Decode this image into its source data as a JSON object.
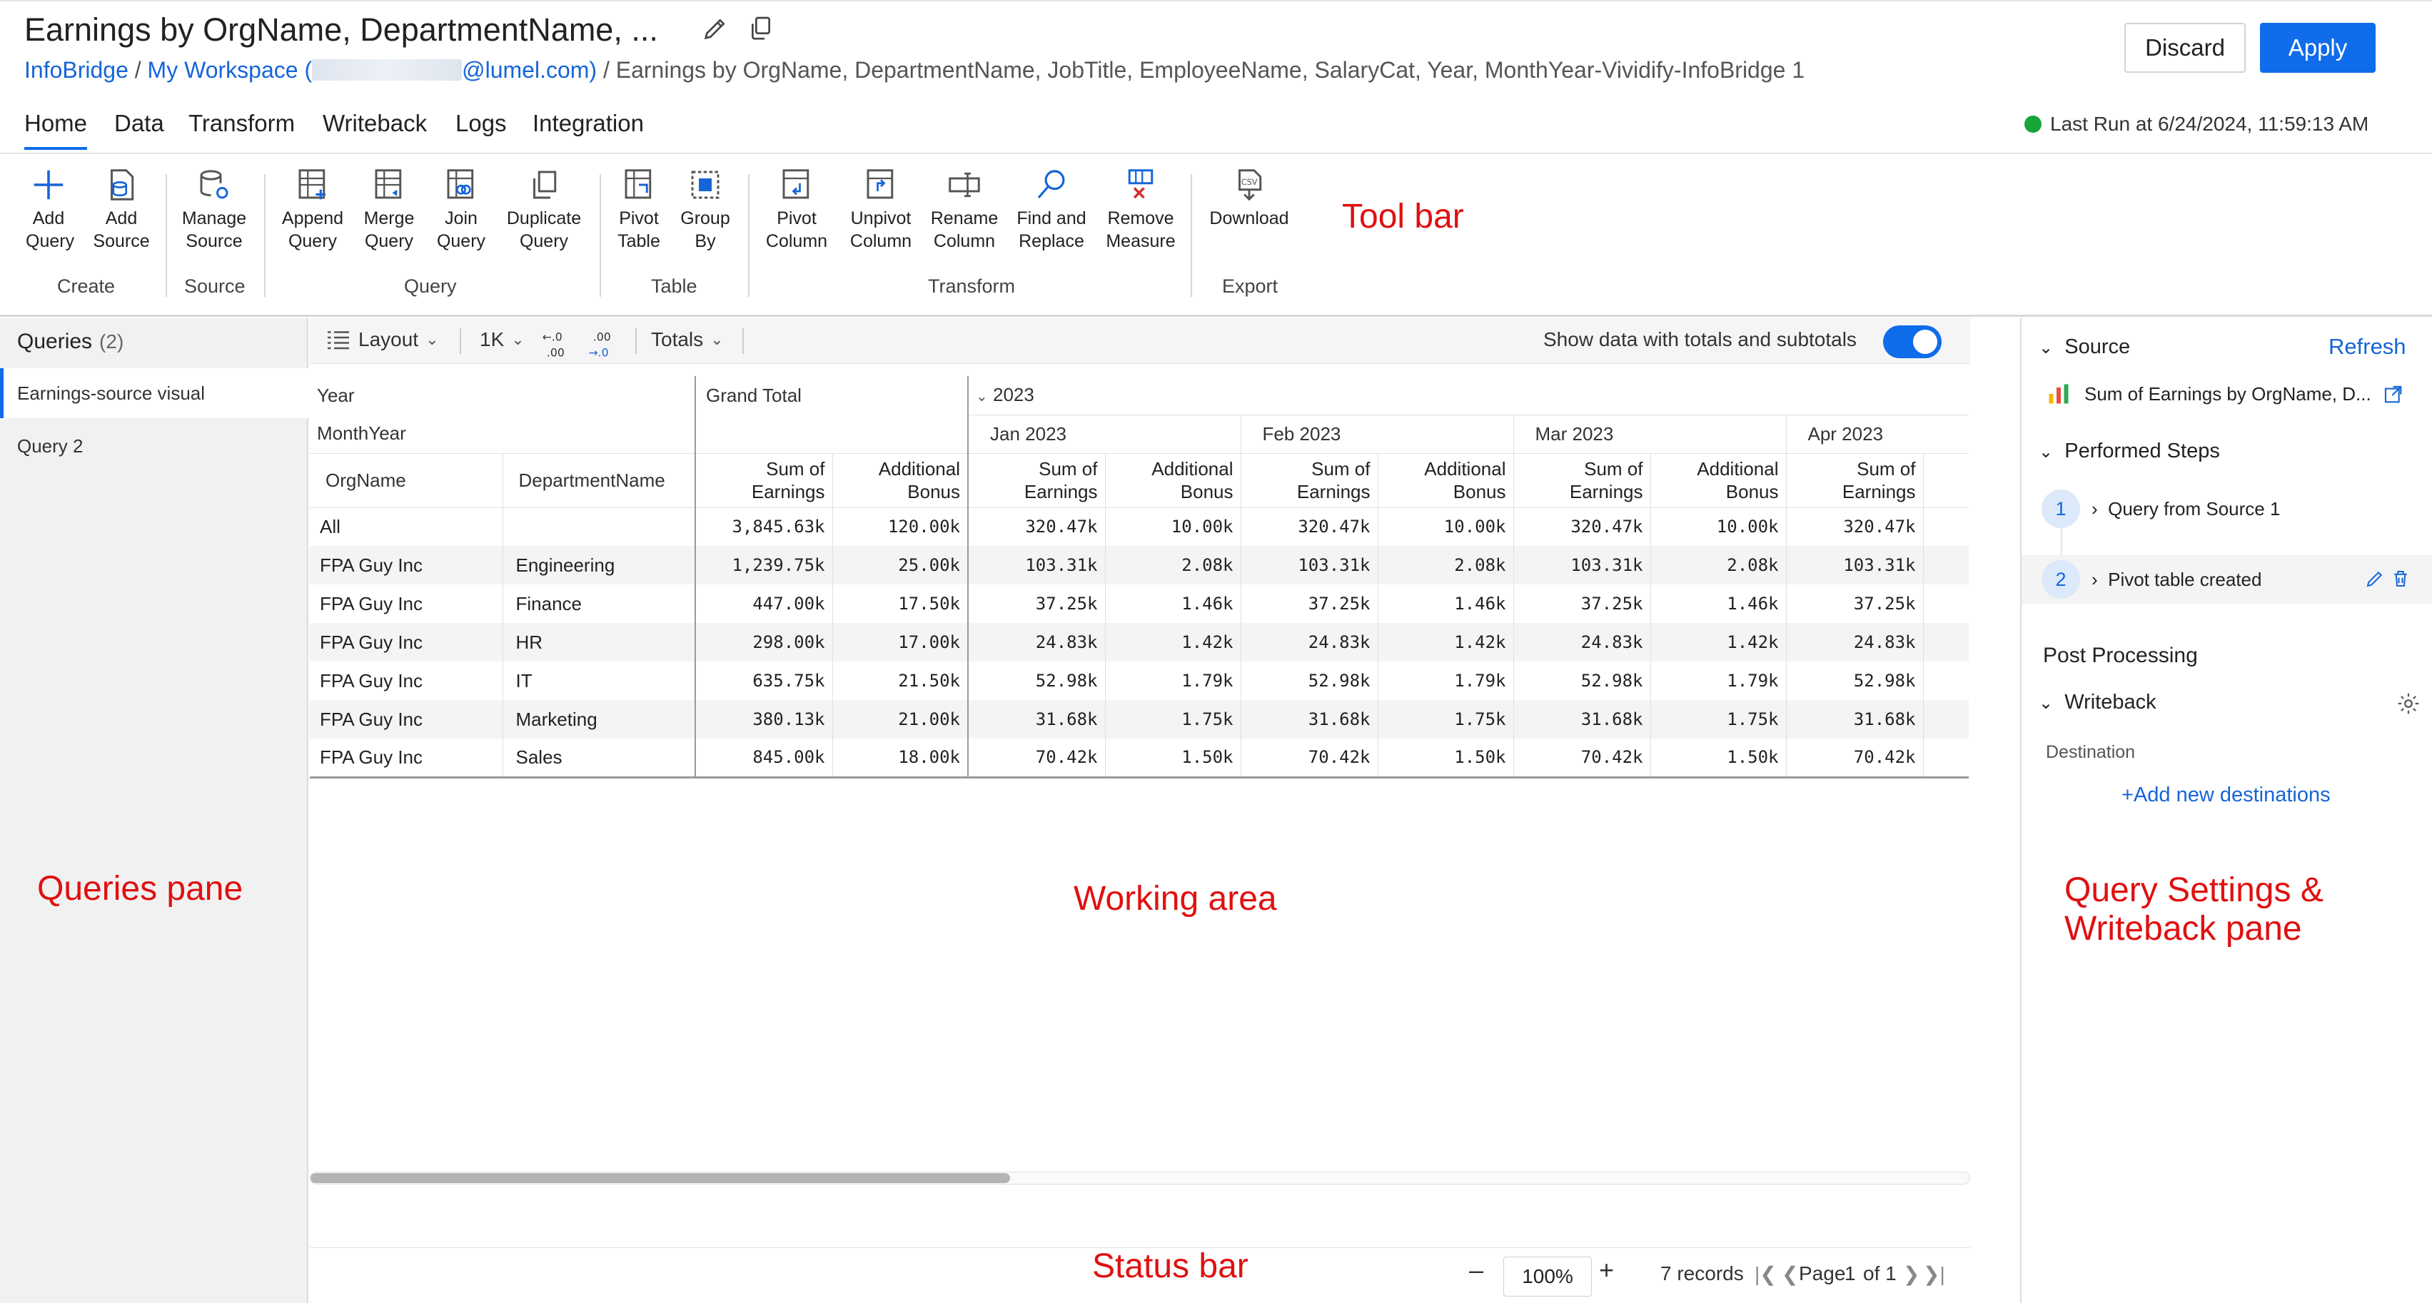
{
  "header": {
    "title": "Earnings by OrgName, DepartmentName, ...",
    "breadcrumb": {
      "part1": "InfoBridge",
      "sep1": " / ",
      "part2_prefix": "My Workspace (",
      "part2_suffix": "@lumel.com)",
      "rest": " / Earnings by OrgName, DepartmentName, JobTitle, EmployeeName, SalaryCat, Year, MonthYear-Vividify-InfoBridge 1"
    },
    "discard_label": "Discard",
    "apply_label": "Apply",
    "icons": [
      "pencil-icon",
      "copy-icon"
    ]
  },
  "menu": {
    "tabs": [
      "Home",
      "Data",
      "Transform",
      "Writeback",
      "Logs",
      "Integration"
    ],
    "active": "Home",
    "last_run": "Last Run at 6/24/2024, 11:59:13 AM",
    "status_color": "#17a53a"
  },
  "toolbar": {
    "items": {
      "add_query": [
        "Add",
        "Query"
      ],
      "add_source": [
        "Add",
        "Source"
      ],
      "manage_source": [
        "Manage",
        "Source"
      ],
      "append_query": [
        "Append",
        "Query"
      ],
      "merge_query": [
        "Merge",
        "Query"
      ],
      "join_query": [
        "Join",
        "Query"
      ],
      "duplicate_query": [
        "Duplicate",
        "Query"
      ],
      "pivot_table": [
        "Pivot",
        "Table"
      ],
      "group_by": [
        "Group",
        "By"
      ],
      "pivot_column": [
        "Pivot",
        "Column"
      ],
      "unpivot_column": [
        "Unpivot",
        "Column"
      ],
      "rename_column": [
        "Rename",
        "Column"
      ],
      "find_replace": [
        "Find and",
        "Replace"
      ],
      "remove_measure": [
        "Remove",
        "Measure"
      ],
      "download": [
        "Download",
        ""
      ]
    },
    "groups": {
      "create": "Create",
      "source": "Source",
      "query": "Query",
      "table": "Table",
      "transform": "Transform",
      "export": "Export"
    }
  },
  "annotations": {
    "toolbar": "Tool bar",
    "queries": "Queries pane",
    "working": "Working area",
    "settings_line1": "Query Settings &",
    "settings_line2": "Writeback pane",
    "status": "Status bar"
  },
  "queries_pane": {
    "title": "Queries",
    "count": "(2)",
    "items": [
      "Earnings-source visual",
      "Query 2"
    ]
  },
  "workbar": {
    "layout": "Layout",
    "rows": "1K",
    "totals": "Totals",
    "show_totals_label": "Show data with totals and subtotals",
    "show_totals_on": true,
    "decimal_icons": [
      "decrease-decimal-icon",
      "increase-decimal-icon"
    ]
  },
  "grid": {
    "year_label": "Year",
    "monthyear_label": "MonthYear",
    "grand_total": "Grand Total",
    "year_value": "2023",
    "months": [
      "Jan 2023",
      "Feb 2023",
      "Mar 2023",
      "Apr 2023"
    ],
    "col_org": "OrgName",
    "col_dept": "DepartmentName",
    "measures": {
      "sum_line1": "Sum of",
      "sum_line2": "Earnings",
      "bonus_line1": "Additional",
      "bonus_line2": "Bonus"
    },
    "rows": [
      {
        "org": "All",
        "dept": "",
        "gt_sum": "3,845.63k",
        "gt_bonus": "120.00k",
        "m_sum": "320.47k",
        "m_bonus": "10.00k"
      },
      {
        "org": "FPA Guy Inc",
        "dept": "Engineering",
        "gt_sum": "1,239.75k",
        "gt_bonus": "25.00k",
        "m_sum": "103.31k",
        "m_bonus": "2.08k"
      },
      {
        "org": "FPA Guy Inc",
        "dept": "Finance",
        "gt_sum": "447.00k",
        "gt_bonus": "17.50k",
        "m_sum": "37.25k",
        "m_bonus": "1.46k"
      },
      {
        "org": "FPA Guy Inc",
        "dept": "HR",
        "gt_sum": "298.00k",
        "gt_bonus": "17.00k",
        "m_sum": "24.83k",
        "m_bonus": "1.42k"
      },
      {
        "org": "FPA Guy Inc",
        "dept": "IT",
        "gt_sum": "635.75k",
        "gt_bonus": "21.50k",
        "m_sum": "52.98k",
        "m_bonus": "1.79k"
      },
      {
        "org": "FPA Guy Inc",
        "dept": "Marketing",
        "gt_sum": "380.13k",
        "gt_bonus": "21.00k",
        "m_sum": "31.68k",
        "m_bonus": "1.75k"
      },
      {
        "org": "FPA Guy Inc",
        "dept": "Sales",
        "gt_sum": "845.00k",
        "gt_bonus": "18.00k",
        "m_sum": "70.42k",
        "m_bonus": "1.50k"
      }
    ]
  },
  "statusbar": {
    "zoom": "100%",
    "records": "7 records",
    "page": "Page",
    "page_num": "1",
    "of": "of 1"
  },
  "settings_pane": {
    "source_title": "Source",
    "refresh": "Refresh",
    "source_name": "Sum of Earnings by OrgName, D...",
    "performed_steps": "Performed Steps",
    "steps": [
      {
        "num": "1",
        "label": "Query from Source 1"
      },
      {
        "num": "2",
        "label": "Pivot table created"
      }
    ],
    "post_processing": "Post Processing",
    "writeback": "Writeback",
    "destination": "Destination",
    "add_destination": "+Add new destinations"
  }
}
